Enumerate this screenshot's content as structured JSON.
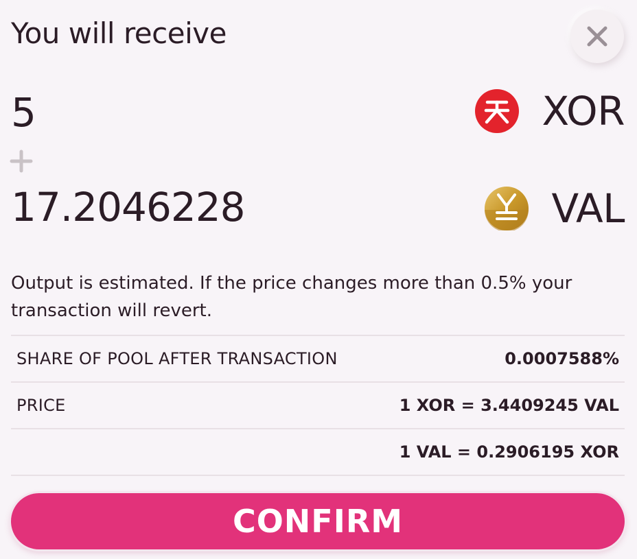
{
  "header": {
    "title": "You will receive",
    "close_icon": "close-icon"
  },
  "receive": {
    "first": {
      "amount": "5",
      "symbol": "XOR",
      "icon": "xor-token-icon",
      "icon_color": "#e3232c"
    },
    "separator_icon": "plus-icon",
    "second": {
      "amount": "17.2046228",
      "symbol": "VAL",
      "icon": "val-token-icon",
      "icon_color": "#c9982a"
    }
  },
  "note": "Output is estimated. If the price changes more than 0.5% your transaction will revert.",
  "info": {
    "share_label": "SHARE OF POOL AFTER TRANSACTION",
    "share_value": "0.0007588%",
    "price_label": "PRICE",
    "price_value_1": "1 XOR = 3.4409245 VAL",
    "price_value_2": "1 VAL = 0.2906195 XOR"
  },
  "confirm_label": "CONFIRM",
  "colors": {
    "accent": "#e2327a",
    "text": "#2b1c26",
    "background": "#f8f4f8"
  }
}
